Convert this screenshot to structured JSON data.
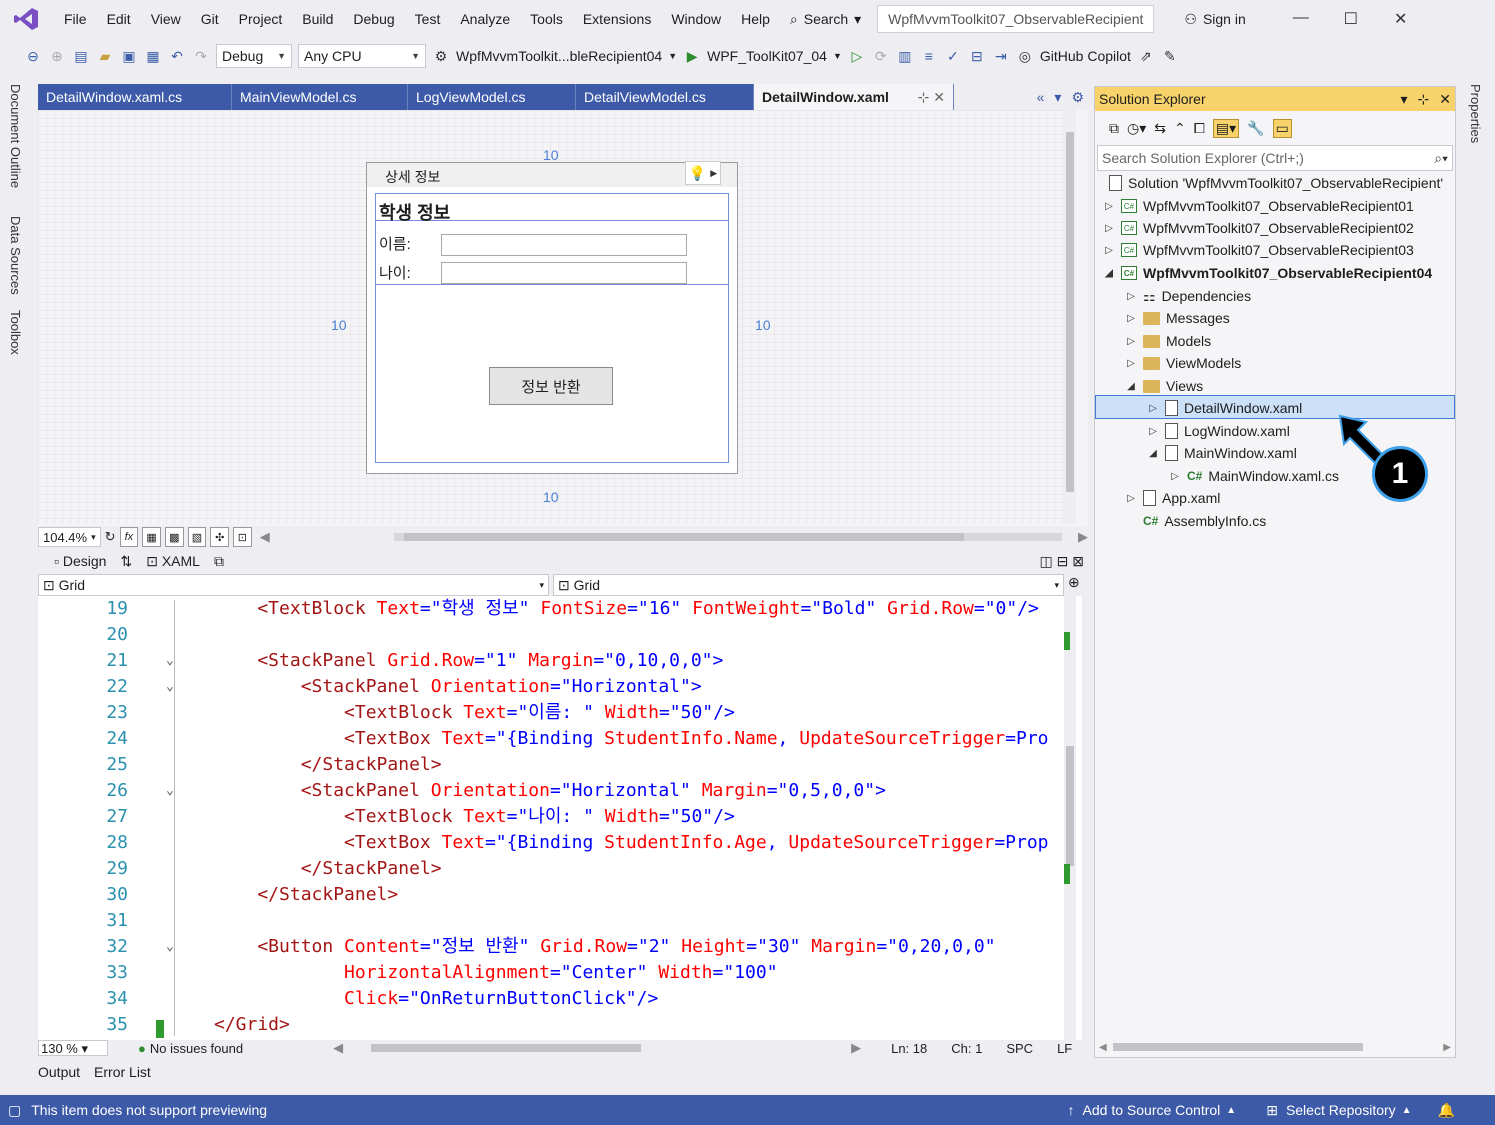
{
  "menu": [
    "File",
    "Edit",
    "View",
    "Git",
    "Project",
    "Build",
    "Debug",
    "Test",
    "Analyze",
    "Tools",
    "Extensions",
    "Window",
    "Help"
  ],
  "search_label": "Search",
  "solution_title": "WpfMvvmToolkit07_ObservableRecipient",
  "sign_in": "Sign in",
  "toolbar": {
    "config": "Debug",
    "platform": "Any CPU",
    "startup_project": "WpfMvvmToolkit...bleRecipient04",
    "run_target": "WPF_ToolKit07_04",
    "copilot": "GitHub Copilot"
  },
  "side_tabs_left": [
    "Document Outline",
    "Data Sources",
    "Toolbox"
  ],
  "side_tabs_right": [
    "Properties"
  ],
  "doc_tabs": [
    "DetailWindow.xaml.cs",
    "MainViewModel.cs",
    "LogViewModel.cs",
    "DetailViewModel.cs",
    "DetailWindow.xaml"
  ],
  "designer": {
    "window_title": "상세 정보",
    "heading": "학생 정보",
    "name_label": "이름:",
    "age_label": "나이:",
    "button": "정보 반환",
    "margins": [
      "10",
      "10",
      "10",
      "10"
    ],
    "zoom": "104.4%",
    "design_tab": "Design",
    "xaml_tab": "XAML",
    "crumb_left": "Grid",
    "crumb_right": "Grid"
  },
  "code_lines": [
    {
      "n": "19",
      "fold": "",
      "t": [
        [
          "tg",
          "    <TextBlock "
        ],
        [
          "at",
          "Text"
        ],
        [
          "bl",
          "=\"학생 정보\" "
        ],
        [
          "at",
          "FontSize"
        ],
        [
          "bl",
          "=\"16\" "
        ],
        [
          "at",
          "FontWeight"
        ],
        [
          "bl",
          "=\"Bold\" "
        ],
        [
          "at",
          "Grid.Row"
        ],
        [
          "bl",
          "=\"0\"/>"
        ]
      ]
    },
    {
      "n": "20",
      "fold": "",
      "t": []
    },
    {
      "n": "21",
      "fold": "⌄",
      "t": [
        [
          "tg",
          "    <StackPanel "
        ],
        [
          "at",
          "Grid.Row"
        ],
        [
          "bl",
          "=\"1\" "
        ],
        [
          "at",
          "Margin"
        ],
        [
          "bl",
          "=\"0,10,0,0\">"
        ]
      ]
    },
    {
      "n": "22",
      "fold": "⌄",
      "t": [
        [
          "tg",
          "        <StackPanel "
        ],
        [
          "at",
          "Orientation"
        ],
        [
          "bl",
          "=\"Horizontal\">"
        ]
      ]
    },
    {
      "n": "23",
      "fold": "",
      "t": [
        [
          "tg",
          "            <TextBlock "
        ],
        [
          "at",
          "Text"
        ],
        [
          "bl",
          "=\"이름: \" "
        ],
        [
          "at",
          "Width"
        ],
        [
          "bl",
          "=\"50\"/>"
        ]
      ]
    },
    {
      "n": "24",
      "fold": "",
      "t": [
        [
          "tg",
          "            <TextBox "
        ],
        [
          "at",
          "Text"
        ],
        [
          "bl",
          "=\"{Binding "
        ],
        [
          "at",
          "StudentInfo.Name"
        ],
        [
          "bl",
          ", "
        ],
        [
          "at",
          "UpdateSourceTrigger"
        ],
        [
          "bl",
          "=Pro"
        ]
      ]
    },
    {
      "n": "25",
      "fold": "",
      "t": [
        [
          "tg",
          "        </StackPanel>"
        ]
      ]
    },
    {
      "n": "26",
      "fold": "⌄",
      "t": [
        [
          "tg",
          "        <StackPanel "
        ],
        [
          "at",
          "Orientation"
        ],
        [
          "bl",
          "=\"Horizontal\" "
        ],
        [
          "at",
          "Margin"
        ],
        [
          "bl",
          "=\"0,5,0,0\">"
        ]
      ]
    },
    {
      "n": "27",
      "fold": "",
      "t": [
        [
          "tg",
          "            <TextBlock "
        ],
        [
          "at",
          "Text"
        ],
        [
          "bl",
          "=\"나이: \" "
        ],
        [
          "at",
          "Width"
        ],
        [
          "bl",
          "=\"50\"/>"
        ]
      ]
    },
    {
      "n": "28",
      "fold": "",
      "t": [
        [
          "tg",
          "            <TextBox "
        ],
        [
          "at",
          "Text"
        ],
        [
          "bl",
          "=\"{Binding "
        ],
        [
          "at",
          "StudentInfo.Age"
        ],
        [
          "bl",
          ", "
        ],
        [
          "at",
          "UpdateSourceTrigger"
        ],
        [
          "bl",
          "=Prop"
        ]
      ]
    },
    {
      "n": "29",
      "fold": "",
      "t": [
        [
          "tg",
          "        </StackPanel>"
        ]
      ]
    },
    {
      "n": "30",
      "fold": "",
      "t": [
        [
          "tg",
          "    </StackPanel>"
        ]
      ]
    },
    {
      "n": "31",
      "fold": "",
      "t": []
    },
    {
      "n": "32",
      "fold": "⌄",
      "t": [
        [
          "tg",
          "    <Button "
        ],
        [
          "at",
          "Content"
        ],
        [
          "bl",
          "=\"정보 반환\" "
        ],
        [
          "at",
          "Grid.Row"
        ],
        [
          "bl",
          "=\"2\" "
        ],
        [
          "at",
          "Height"
        ],
        [
          "bl",
          "=\"30\" "
        ],
        [
          "at",
          "Margin"
        ],
        [
          "bl",
          "=\"0,20,0,0\""
        ]
      ]
    },
    {
      "n": "33",
      "fold": "",
      "t": [
        [
          "at",
          "            HorizontalAlignment"
        ],
        [
          "bl",
          "=\"Center\" "
        ],
        [
          "at",
          "Width"
        ],
        [
          "bl",
          "=\"100\""
        ]
      ]
    },
    {
      "n": "34",
      "fold": "",
      "t": [
        [
          "at",
          "            Click"
        ],
        [
          "bl",
          "=\"OnReturnButtonClick\"/>"
        ]
      ]
    },
    {
      "n": "35",
      "fold": "",
      "t": [
        [
          "tg",
          "</Grid>"
        ]
      ]
    }
  ],
  "code_status": {
    "zoom": "130 %",
    "issues": "No issues found",
    "ln": "Ln: 18",
    "ch": "Ch: 1",
    "spc": "SPC",
    "lf": "LF"
  },
  "bottom_tabs": [
    "Output",
    "Error List"
  ],
  "status": {
    "left": "This item does not support previewing",
    "source": "Add to Source Control",
    "repo": "Select Repository"
  },
  "solution_explorer": {
    "title": "Solution Explorer",
    "search_placeholder": "Search Solution Explorer (Ctrl+;)",
    "solution": "Solution 'WpfMvvmToolkit07_ObservableRecipient'",
    "projects": [
      "WpfMvvmToolkit07_ObservableRecipient01",
      "WpfMvvmToolkit07_ObservableRecipient02",
      "WpfMvvmToolkit07_ObservableRecipient03",
      "WpfMvvmToolkit07_ObservableRecipient04"
    ],
    "items": [
      "Dependencies",
      "Messages",
      "Models",
      "ViewModels",
      "Views",
      "DetailWindow.xaml",
      "LogWindow.xaml",
      "MainWindow.xaml",
      "MainWindow.xaml.cs",
      "App.xaml",
      "AssemblyInfo.cs"
    ]
  },
  "callout": "1",
  "colors": {
    "accent": "#3d5aa8",
    "se_header": "#f8d26a",
    "selection": "#cce0f7"
  }
}
